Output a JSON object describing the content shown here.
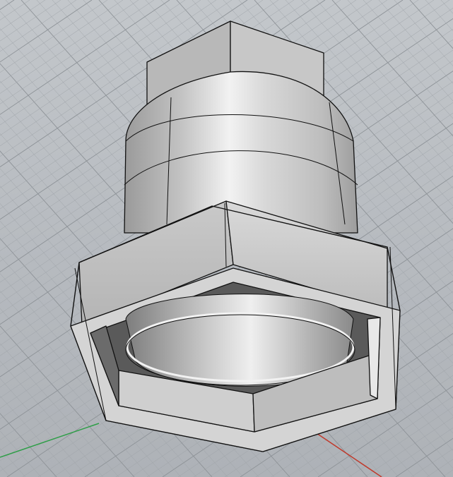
{
  "scene": {
    "background_color": "#b9bdc2",
    "grid_color": "#9ea3a8",
    "grid_major_color": "#8d9297",
    "axis_x_color": "#c0392b",
    "axis_y_color": "#2e9e47",
    "model_light": "#f4f4f4",
    "model_mid": "#c9c9c9",
    "model_dark": "#8c8c8c",
    "edge_color": "#111111"
  }
}
